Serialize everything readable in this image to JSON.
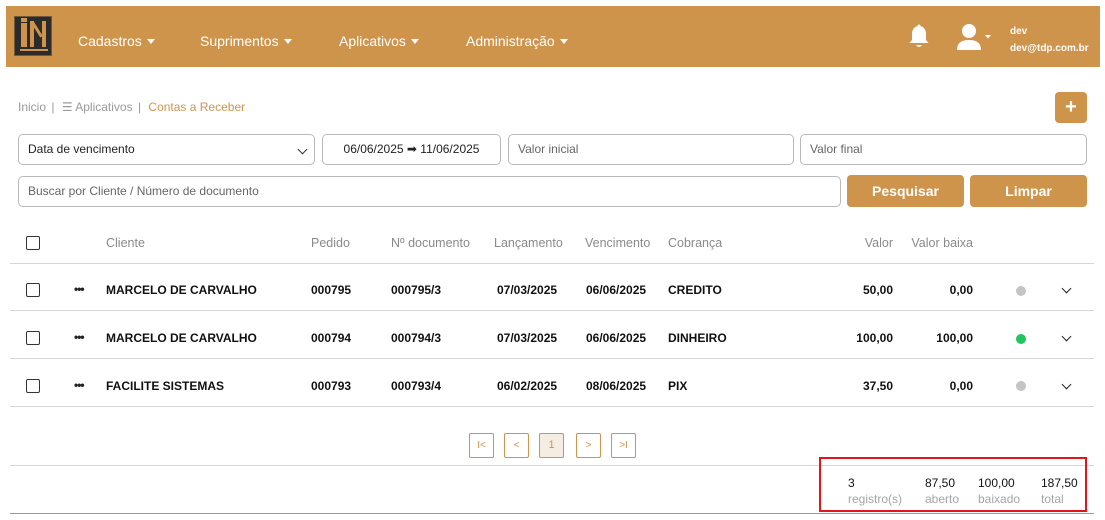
{
  "header": {
    "menu": [
      {
        "label": "Cadastros"
      },
      {
        "label": "Suprimentos"
      },
      {
        "label": "Aplicativos"
      },
      {
        "label": "Administração"
      }
    ],
    "user_name": "dev",
    "user_email": "dev@tdp.com.br"
  },
  "breadcrumb": {
    "home": "Inicio",
    "apps": "Aplicativos",
    "current": "Contas a Receber"
  },
  "add_button": "+",
  "filters": {
    "date_type": "Data de vencimento",
    "date_range": "06/06/2025 ➡ 11/06/2025",
    "valor_inicial_placeholder": "Valor inicial",
    "valor_final_placeholder": "Valor final",
    "search_placeholder": "Buscar por Cliente / Número de documento",
    "search_button": "Pesquisar",
    "clear_button": "Limpar"
  },
  "table": {
    "columns": {
      "cliente": "Cliente",
      "pedido": "Pedido",
      "documento": "Nº documento",
      "lancamento": "Lançamento",
      "vencimento": "Vencimento",
      "cobranca": "Cobrança",
      "valor": "Valor",
      "valor_baixa": "Valor baixa"
    },
    "rows": [
      {
        "cliente": "MARCELO DE CARVALHO",
        "pedido": "000795",
        "documento": "000795/3",
        "lancamento": "07/03/2025",
        "vencimento": "06/06/2025",
        "cobranca": "CREDITO",
        "valor": "50,00",
        "valor_baixa": "0,00",
        "status_color": "#c4c4c4"
      },
      {
        "cliente": "MARCELO DE CARVALHO",
        "pedido": "000794",
        "documento": "000794/3",
        "lancamento": "07/03/2025",
        "vencimento": "06/06/2025",
        "cobranca": "DINHEIRO",
        "valor": "100,00",
        "valor_baixa": "100,00",
        "status_color": "#22c55e"
      },
      {
        "cliente": "FACILITE SISTEMAS",
        "pedido": "000793",
        "documento": "000793/4",
        "lancamento": "06/02/2025",
        "vencimento": "08/06/2025",
        "cobranca": "PIX",
        "valor": "37,50",
        "valor_baixa": "0,00",
        "status_color": "#c4c4c4"
      }
    ]
  },
  "pagination": {
    "first": "I<",
    "prev": "<",
    "current": "1",
    "next": ">",
    "last": ">I"
  },
  "summary": {
    "registros": "3",
    "registros_label": "registro(s)",
    "aberto": "87,50",
    "aberto_label": "aberto",
    "baixado": "100,00",
    "baixado_label": "baixado",
    "total": "187,50",
    "total_label": "total"
  },
  "colors": {
    "brand": "#cf944c",
    "highlight_box": "#e4141b"
  }
}
